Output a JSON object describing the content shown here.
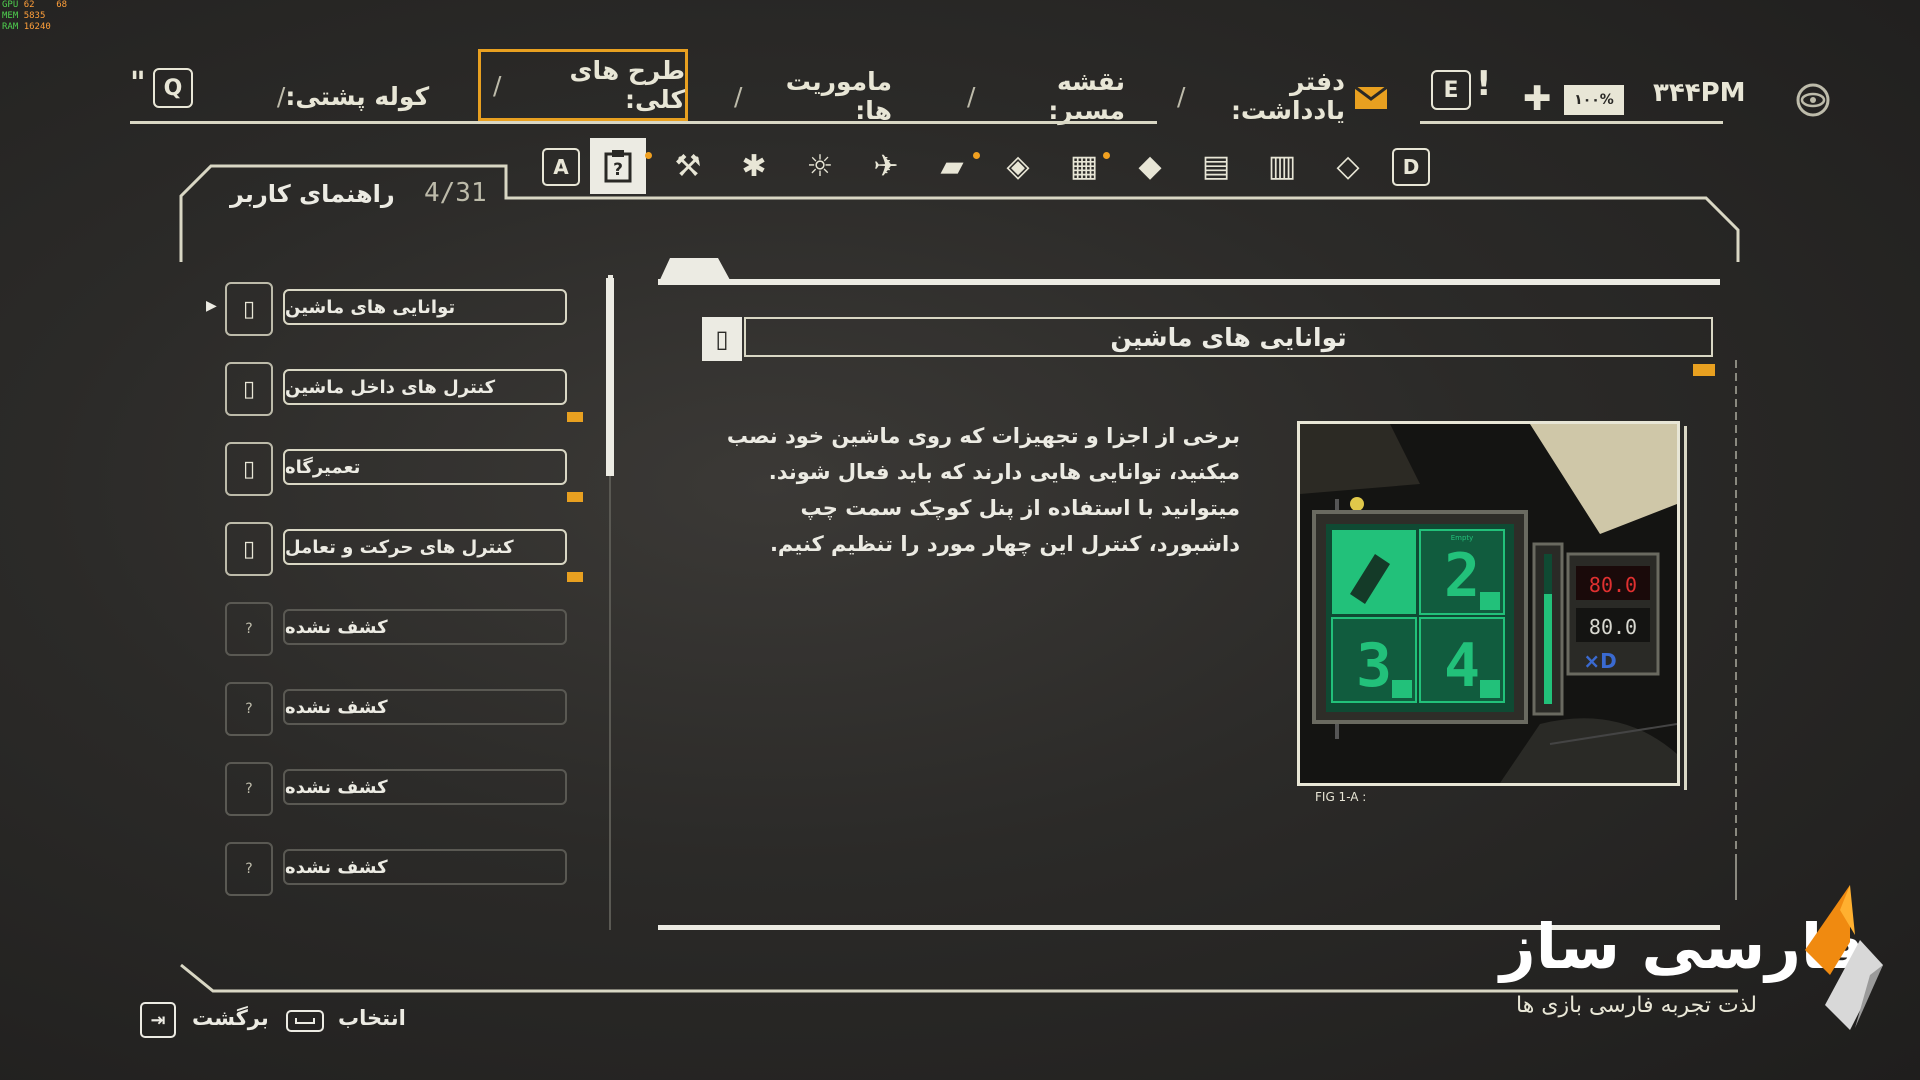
{
  "perf": {
    "gpu_label": "GPU",
    "gpu_value": "62",
    "gpu_value2": "68",
    "mem_label": "MEM",
    "mem_value": "5835",
    "ram_label": "RAM",
    "ram_value": "16240"
  },
  "nav": {
    "key_q": "Q",
    "key_quote": "\"",
    "tabs": [
      {
        "label": "کوله پشتی:"
      },
      {
        "label": "طرح های کلی:"
      },
      {
        "label": "ماموریت ها:"
      },
      {
        "label": "نقشه مسیر:"
      },
      {
        "label": "دفتر یادداشت:"
      }
    ],
    "key_e": "E",
    "alert": "!",
    "health_percent": "۱۰۰%",
    "time": "۳۴۴PM",
    "accent": "#e8a020"
  },
  "panel": {
    "title": "راهنمای کاربر",
    "counter": "4/31"
  },
  "categories": {
    "key_a": "A",
    "key_d": "D",
    "icons": [
      {
        "name": "guide-icon",
        "glyph": "?"
      },
      {
        "name": "tools-icon",
        "glyph": "⚒"
      },
      {
        "name": "bug-icon",
        "glyph": "✱"
      },
      {
        "name": "weather-icon",
        "glyph": "☼"
      },
      {
        "name": "flight-icon",
        "glyph": "✈"
      },
      {
        "name": "car-icon",
        "glyph": "▰"
      },
      {
        "name": "diamond-icon",
        "glyph": "◈"
      },
      {
        "name": "garage-icon",
        "glyph": "▦"
      },
      {
        "name": "paint-icon",
        "glyph": "◆"
      },
      {
        "name": "radio-icon",
        "glyph": "▤"
      },
      {
        "name": "camera-icon",
        "glyph": "▥"
      },
      {
        "name": "compass-icon",
        "glyph": "◇"
      }
    ]
  },
  "list": [
    {
      "label": "توانایی های ماشین",
      "known": true,
      "icon": "manual-icon",
      "new": false,
      "selected": true
    },
    {
      "label": "کنترل های داخل ماشین",
      "known": true,
      "icon": "manual-icon",
      "new": true
    },
    {
      "label": "تعمیرگاه",
      "known": true,
      "icon": "manual-icon",
      "new": true
    },
    {
      "label": "کنترل های حرکت و تعامل",
      "known": true,
      "icon": "manual-icon",
      "new": true
    },
    {
      "label": "کشف نشده",
      "known": false,
      "icon_glyph": "?"
    },
    {
      "label": "کشف نشده",
      "known": false,
      "icon_glyph": "?"
    },
    {
      "label": "کشف نشده",
      "known": false,
      "icon_glyph": "?"
    },
    {
      "label": "کشف نشده",
      "known": false,
      "icon_glyph": "?"
    }
  ],
  "article": {
    "title": "توانایی های ماشین",
    "body": "برخی از اجزا و تجهیزات که روی ماشین خود نصب میکنید، توانایی هایی دارند که باید فعال شوند. میتوانید با استفاده از پنل کوچک سمت چپ داشبورد، کنترل این چهار مورد را تنظیم کنیم.",
    "figure_caption": "FIG 1-A :",
    "figure": {
      "slot_2": "2",
      "slot_3": "3",
      "slot_4": "4",
      "slot_label": "Empty",
      "readout_1": "80.0",
      "readout_2": "80.0",
      "logo": "×D"
    }
  },
  "footer": {
    "back_label": "برگشت",
    "select_label": "انتخاب"
  },
  "watermark": {
    "brand": "فارسی ساز",
    "tagline": "لذت تجربه فارسی بازی ها"
  }
}
